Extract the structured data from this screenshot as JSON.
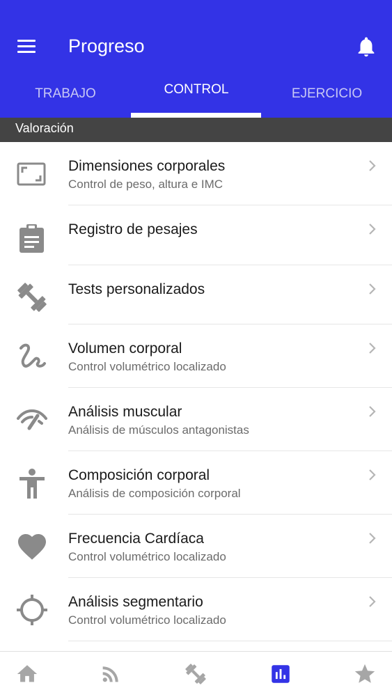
{
  "app": {
    "title": "Progreso"
  },
  "tabs": [
    {
      "label": "TRABAJO",
      "active": false
    },
    {
      "label": "CONTROL",
      "active": true
    },
    {
      "label": "EJERCICIO",
      "active": false
    }
  ],
  "section": {
    "title": "Valoración"
  },
  "items": [
    {
      "icon": "aspect-ratio-icon",
      "label": "Dimensiones corporales",
      "subtitle": "Control de peso, altura e IMC"
    },
    {
      "icon": "clipboard-icon",
      "label": "Registro de pesajes",
      "subtitle": ""
    },
    {
      "icon": "dumbbell-icon",
      "label": "Tests personalizados",
      "subtitle": ""
    },
    {
      "icon": "gesture-icon",
      "label": "Volumen corporal",
      "subtitle": "Control volumétrico localizado"
    },
    {
      "icon": "gauge-icon",
      "label": "Análisis muscular",
      "subtitle": "Análisis de músculos antagonistas"
    },
    {
      "icon": "body-icon",
      "label": "Composición corporal",
      "subtitle": "Análisis de composición corporal"
    },
    {
      "icon": "heart-icon",
      "label": "Frecuencia Cardíaca",
      "subtitle": "Control volumétrico localizado"
    },
    {
      "icon": "crosshair-icon",
      "label": "Análisis segmentario",
      "subtitle": "Control volumétrico localizado"
    }
  ],
  "bottom_nav": [
    {
      "icon": "home-icon",
      "active": false
    },
    {
      "icon": "rss-feed-icon",
      "active": false
    },
    {
      "icon": "dumbbell-icon",
      "active": false
    },
    {
      "icon": "bar-chart-icon",
      "active": true
    },
    {
      "icon": "star-icon",
      "active": false
    }
  ],
  "colors": {
    "primary": "#3333e6",
    "section_header": "#444444",
    "icon_gray": "#8a8a8a",
    "nav_inactive": "#a6a6a6"
  }
}
